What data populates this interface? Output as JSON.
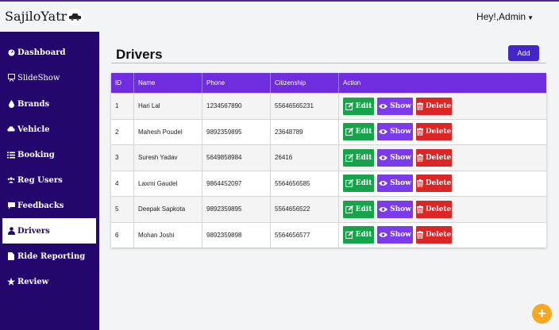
{
  "app": {
    "brand": "SajiloYatra",
    "user_greeting": "Hey!,Admin"
  },
  "sidebar": {
    "items": [
      {
        "label": "Dashboard",
        "icon": "dashboard-icon"
      },
      {
        "label": "SlideShow",
        "icon": "slideshow-icon"
      },
      {
        "label": "Brands",
        "icon": "drop-icon"
      },
      {
        "label": "Vehicle",
        "icon": "car-icon"
      },
      {
        "label": "Booking",
        "icon": "list-icon"
      },
      {
        "label": "Reg Users",
        "icon": "users-icon"
      },
      {
        "label": "Feedbacks",
        "icon": "comment-icon"
      },
      {
        "label": "Drivers",
        "icon": "user-icon",
        "active": true
      },
      {
        "label": "Ride Reporting",
        "icon": "file-icon"
      },
      {
        "label": "Review",
        "icon": "star-icon"
      }
    ]
  },
  "main": {
    "title": "Drivers",
    "add_label": "Add",
    "columns": [
      "ID",
      "Name",
      "Phone",
      "Citizenship",
      "Action"
    ],
    "actions": {
      "edit": "Edit",
      "show": "Show",
      "delete": "Delete"
    },
    "rows": [
      {
        "id": "1",
        "name": "Hari Lal",
        "phone": "1234567890",
        "citizenship": "55646565231"
      },
      {
        "id": "2",
        "name": "Mahesh Poudel",
        "phone": "9892359895",
        "citizenship": "23648789"
      },
      {
        "id": "3",
        "name": "Suresh Yadav",
        "phone": "5649858984",
        "citizenship": "26416"
      },
      {
        "id": "4",
        "name": "Laxmi Gaudel",
        "phone": "9864452097",
        "citizenship": "5564656585"
      },
      {
        "id": "5",
        "name": "Deepak Sapkota",
        "phone": "9892359895",
        "citizenship": "5564656522"
      },
      {
        "id": "6",
        "name": "Mohan Joshi",
        "phone": "9892359898",
        "citizenship": "5564656577"
      }
    ]
  },
  "fab": {
    "label": "+"
  },
  "colors": {
    "sidebar": "#24076c",
    "header": "#6f2ddf",
    "add": "#4326c8",
    "edit": "#16a34a",
    "show": "#7c3aed",
    "delete": "#dc2626",
    "fab": "#f7a823"
  }
}
